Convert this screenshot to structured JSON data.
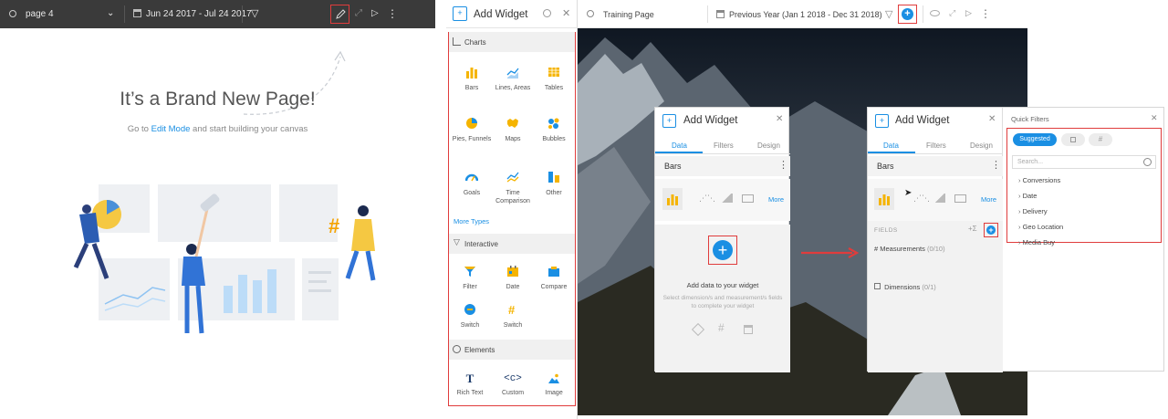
{
  "left": {
    "page_name": "page 4",
    "date_range": "Jun 24 2017 - Jul 24 2017",
    "heading": "It’s a Brand New Page!",
    "sub_before": "Go to",
    "sub_link": "Edit Mode",
    "sub_after": "and start building your canvas"
  },
  "add_widget": {
    "title": "Add Widget",
    "charts_label": "Charts",
    "chart_items": [
      {
        "label": "Bars",
        "icon": "bars-icon"
      },
      {
        "label": "Lines, Areas",
        "icon": "lines-icon"
      },
      {
        "label": "Tables",
        "icon": "tables-icon"
      },
      {
        "label": "Pies, Funnels",
        "icon": "pie-icon"
      },
      {
        "label": "Maps",
        "icon": "map-icon"
      },
      {
        "label": "Bubbles",
        "icon": "bubbles-icon"
      },
      {
        "label": "Goals",
        "icon": "gauge-icon"
      },
      {
        "label": "Time Comparison",
        "icon": "time-comparison-icon"
      },
      {
        "label": "Other",
        "icon": "other-icon"
      }
    ],
    "more_types": "More Types",
    "interactive_label": "Interactive",
    "interactive_items": [
      {
        "label": "Filter",
        "icon": "filter-icon"
      },
      {
        "label": "Date",
        "icon": "calendar-icon"
      },
      {
        "label": "Compare",
        "icon": "compare-icon"
      },
      {
        "label": "Switch",
        "icon": "switch-icon"
      },
      {
        "label": "Switch",
        "icon": "switch-hash-icon"
      }
    ],
    "elements_label": "Elements",
    "element_items": [
      {
        "label": "Rich Text",
        "icon": "text-icon"
      },
      {
        "label": "Custom",
        "icon": "code-icon"
      },
      {
        "label": "Image",
        "icon": "image-icon"
      }
    ]
  },
  "right_top": {
    "page_name": "Training Page",
    "date_range": "Previous Year (Jan 1 2018 - Dec 31 2018)"
  },
  "widget_panel_1": {
    "title": "Add Widget",
    "tabs": [
      "Data",
      "Filters",
      "Design"
    ],
    "type_label": "Bars",
    "more": "More",
    "add_data_title": "Add data to your widget",
    "add_data_desc": "Select dimension/s and measurement/s fields to complete your widget"
  },
  "widget_panel_2": {
    "title": "Add Widget",
    "tabs": [
      "Data",
      "Filters",
      "Design"
    ],
    "type_label": "Bars",
    "more": "More",
    "fields_label": "FIELDS",
    "measurements_label": "Measurements",
    "measurements_count": "(0/10)",
    "dimensions_label": "Dimensions",
    "dimensions_count": "(0/1)"
  },
  "quick_filters": {
    "title": "Quick Filters",
    "pill_suggested": "Suggested",
    "search_placeholder": "Search...",
    "items": [
      "Conversions",
      "Date",
      "Delivery",
      "Geo Location",
      "Media Buy"
    ]
  },
  "colors": {
    "accent_blue": "#1a8fe3",
    "highlight_red": "#e03c3c",
    "chart_yellow": "#f5b400",
    "topbar_dark": "#3a3a3a"
  }
}
